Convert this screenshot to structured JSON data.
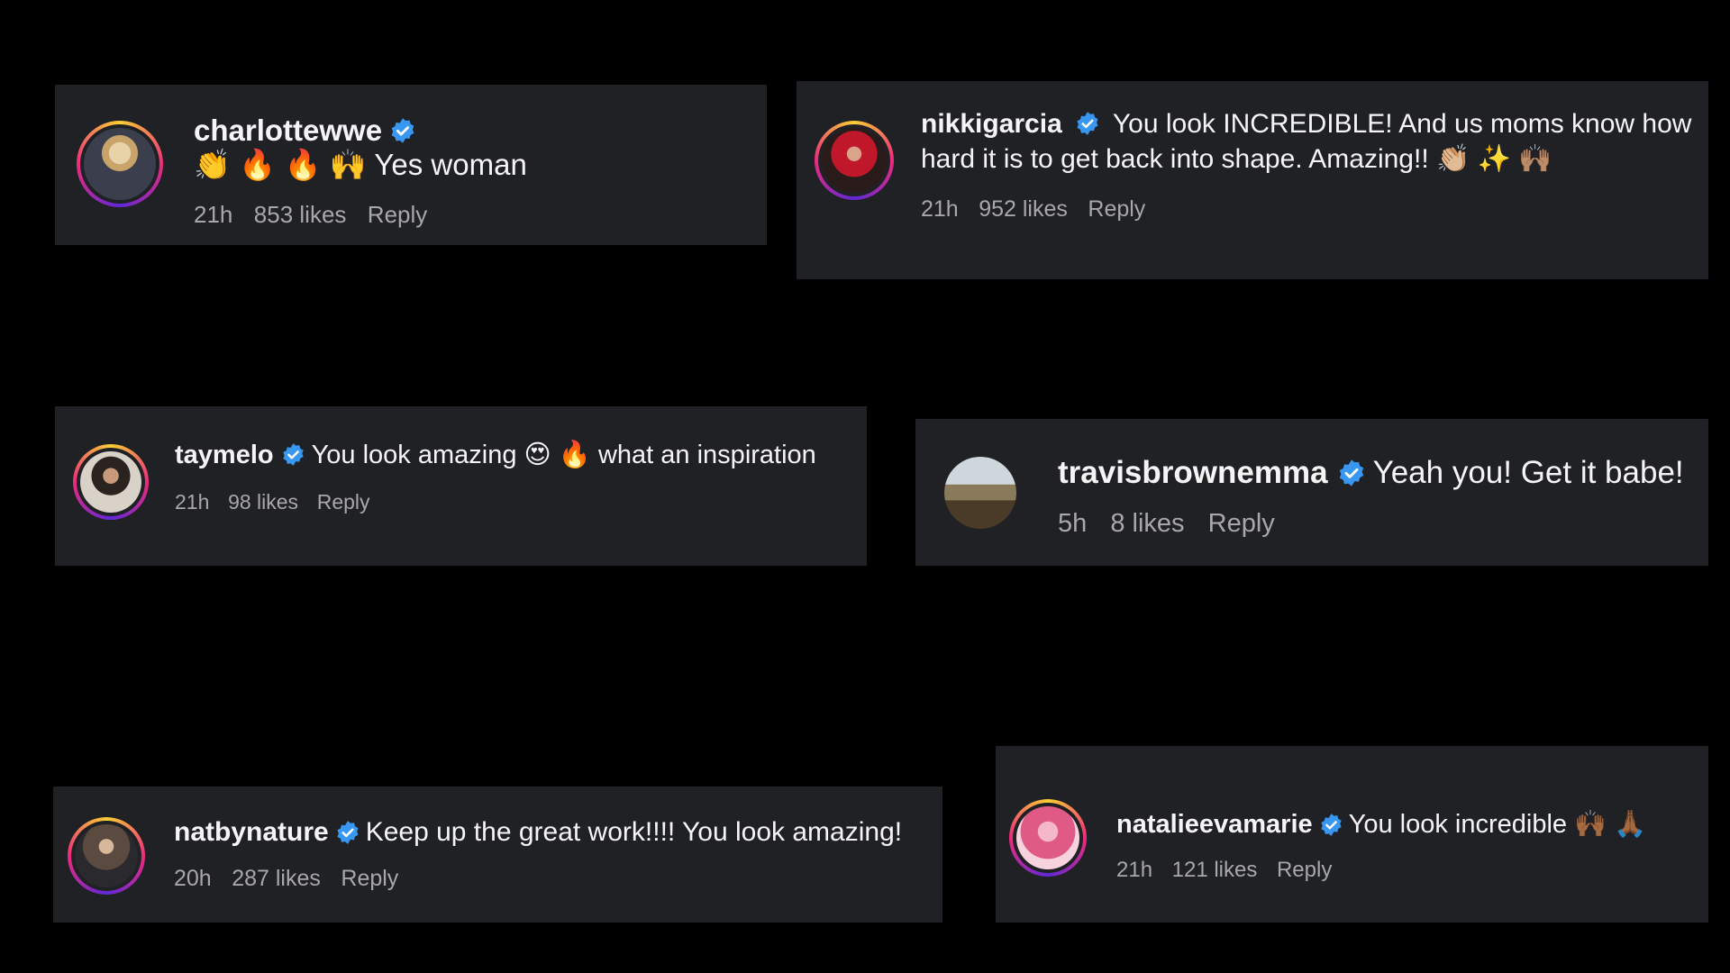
{
  "accent": {
    "verified": "#3897f0",
    "card_background": "#202125",
    "meta_text": "#a8a8a8",
    "page_background": "#000000"
  },
  "comments": [
    {
      "username": "charlottewwe",
      "verified": true,
      "text": "👏 🔥 🔥 🙌 Yes woman",
      "time": "21h",
      "likes": "853 likes",
      "reply_label": "Reply",
      "avatar_ring": true,
      "avatar_icon": "avatar-photo-icon"
    },
    {
      "username": "nikkigarcia",
      "verified": true,
      "text": "You look INCREDIBLE! And us moms know how hard it is to get back into shape. Amazing!! 👏🏼 ✨ 🙌🏽",
      "time": "21h",
      "likes": "952 likes",
      "reply_label": "Reply",
      "avatar_ring": true,
      "avatar_icon": "avatar-photo-icon"
    },
    {
      "username": "taymelo",
      "verified": true,
      "text": "You look amazing 😍 🔥 what an inspiration",
      "time": "21h",
      "likes": "98 likes",
      "reply_label": "Reply",
      "avatar_ring": true,
      "avatar_icon": "avatar-photo-icon"
    },
    {
      "username": "travisbrownemma",
      "verified": true,
      "text": "Yeah you! Get it babe!",
      "time": "5h",
      "likes": "8 likes",
      "reply_label": "Reply",
      "avatar_ring": false,
      "avatar_icon": "avatar-photo-icon"
    },
    {
      "username": "natbynature",
      "verified": true,
      "text": "Keep up the great work!!!! You look amazing!",
      "time": "20h",
      "likes": "287 likes",
      "reply_label": "Reply",
      "avatar_ring": true,
      "avatar_icon": "avatar-photo-icon"
    },
    {
      "username": "natalieevamarie",
      "verified": true,
      "text": "You look incredible 🙌🏾 🙏🏾",
      "time": "21h",
      "likes": "121 likes",
      "reply_label": "Reply",
      "avatar_ring": true,
      "avatar_icon": "avatar-photo-icon"
    }
  ]
}
